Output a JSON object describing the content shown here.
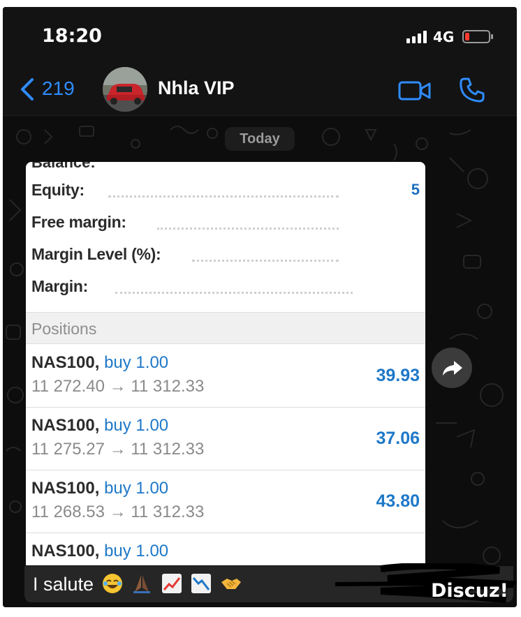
{
  "status_bar": {
    "time": "18:20",
    "network": "4G"
  },
  "header": {
    "back_count": "219",
    "contact_name": "Nhla VIP"
  },
  "chat": {
    "date_label": "Today"
  },
  "account": {
    "cut_label": "Balance:",
    "rows": [
      {
        "label": "Equity:",
        "value": "5"
      },
      {
        "label": "Free margin:",
        "value": ""
      },
      {
        "label": "Margin Level (%):",
        "value": ""
      },
      {
        "label": "Margin:",
        "value": ""
      }
    ]
  },
  "positions": {
    "title": "Positions",
    "items": [
      {
        "symbol": "NAS100,",
        "side": "buy 1.00",
        "prices": "11 272.40 → 11 312.33",
        "profit": "39.93"
      },
      {
        "symbol": "NAS100,",
        "side": "buy 1.00",
        "prices": "11 275.27 → 11 312.33",
        "profit": "37.06"
      },
      {
        "symbol": "NAS100,",
        "side": "buy 1.00",
        "prices": "11 268.53 → 11 312.33",
        "profit": "43.80"
      },
      {
        "symbol": "NAS100,",
        "side": "buy 1.00",
        "prices": "",
        "profit": ""
      }
    ]
  },
  "message": {
    "caption": "I salute"
  },
  "watermark": "Discuz!",
  "colors": {
    "accent": "#2f8cff",
    "profit": "#1e78c8",
    "battery_low": "#ff3b30"
  },
  "icons": [
    "back-chevron-icon",
    "video-call-icon",
    "phone-call-icon",
    "forward-icon",
    "signal-icon",
    "battery-icon"
  ]
}
